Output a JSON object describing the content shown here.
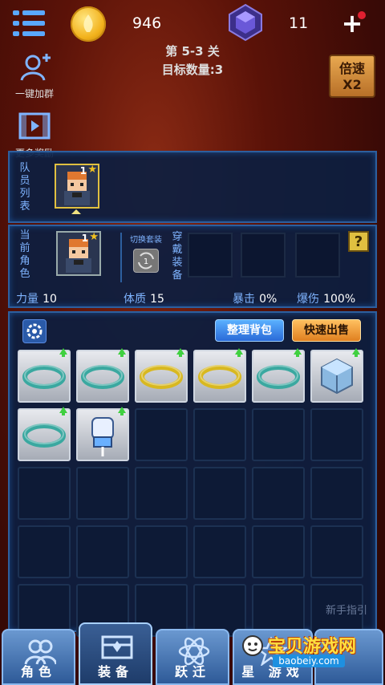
{
  "topbar": {
    "coins": "946",
    "gems": "11",
    "plus": "+",
    "stage": "第 5-3 关",
    "target": "目标数量:3",
    "speed_line1": "倍速",
    "speed_line2": "X2"
  },
  "side": {
    "join_group": "一键加群",
    "more_rewards": "更多奖励"
  },
  "team": {
    "label": [
      "队",
      "员",
      "列",
      "表"
    ],
    "members": [
      {
        "level": "1",
        "star": "★"
      }
    ]
  },
  "role": {
    "label": [
      "当",
      "前",
      "角",
      "色"
    ],
    "level": "1",
    "star": "★",
    "switch_label": "切换套装",
    "switch_value": "1",
    "equip_label": [
      "穿",
      "戴",
      "装",
      "备"
    ],
    "help": "?",
    "stats": [
      {
        "label": "力量",
        "value": "10"
      },
      {
        "label": "体质",
        "value": "15"
      },
      {
        "label": "暴击",
        "value": "0%"
      },
      {
        "label": "爆伤",
        "value": "100%"
      }
    ]
  },
  "bag": {
    "sort_label": "整理背包",
    "sell_label": "快速出售",
    "items": [
      {
        "name": "teal-ring-icon",
        "color": "#3aa8a0",
        "upgrade": true
      },
      {
        "name": "teal-ring-icon",
        "color": "#3aa8a0",
        "upgrade": true
      },
      {
        "name": "gold-ring-icon",
        "color": "#d8b820",
        "upgrade": true
      },
      {
        "name": "gold-ring-icon",
        "color": "#d8b820",
        "upgrade": true
      },
      {
        "name": "teal-ring-icon",
        "color": "#3aa8a0",
        "upgrade": true
      },
      {
        "name": "crystal-cube-icon",
        "color": "#7ab0d8",
        "upgrade": true
      },
      {
        "name": "teal-ring-icon",
        "color": "#3aa8a0",
        "upgrade": true
      },
      {
        "name": "gauntlet-icon",
        "color": "#6ab0ff",
        "upgrade": true
      }
    ],
    "hint": "新手指引"
  },
  "nav": [
    {
      "label": "角色",
      "icon": "people-icon"
    },
    {
      "label": "装备",
      "icon": "chest-icon"
    },
    {
      "label": "跃迁",
      "icon": "atom-icon"
    },
    {
      "label": "星  游戏",
      "icon": "star-icon"
    }
  ],
  "watermark": {
    "title": "宝贝游戏网",
    "url": "baobeiy.com"
  },
  "colors": {
    "panel_border": "#2d5f9e",
    "accent_blue": "#7fb4ff",
    "gold": "#e0c040"
  }
}
